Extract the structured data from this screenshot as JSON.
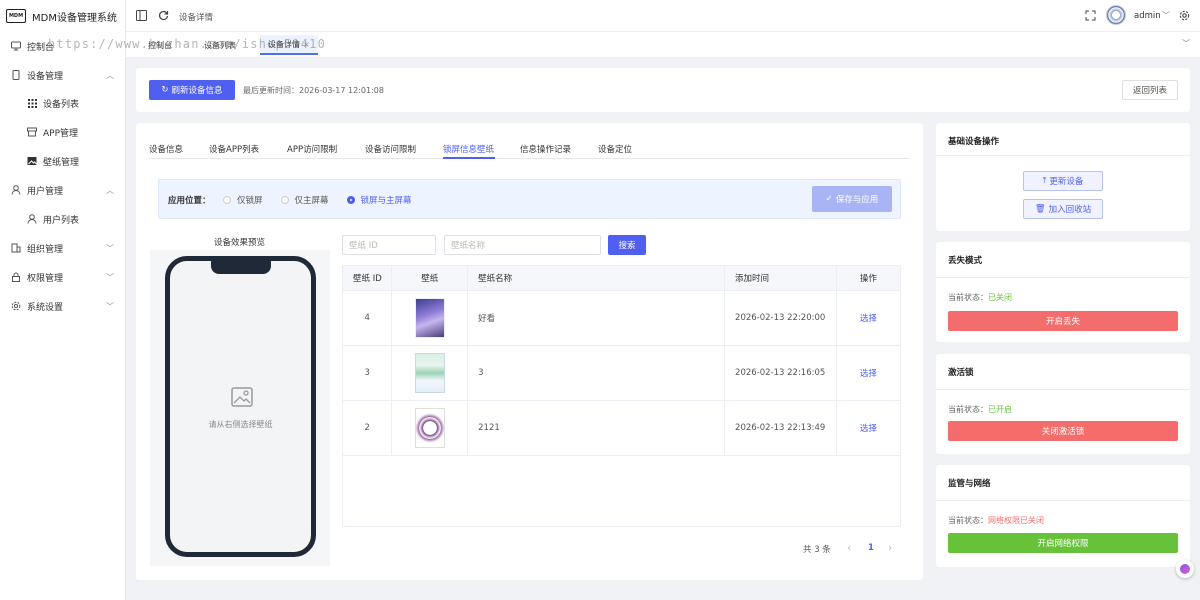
{
  "app": {
    "logo_text": "MDM",
    "title": "MDM设备管理系统"
  },
  "sidebar": {
    "items": [
      {
        "label": "控制台",
        "icon": "monitor-icon"
      },
      {
        "label": "设备管理",
        "icon": "phone-icon"
      },
      {
        "label": "设备列表",
        "icon": "grid-icon"
      },
      {
        "label": "APP管理",
        "icon": "box-icon"
      },
      {
        "label": "壁纸管理",
        "icon": "image-icon"
      },
      {
        "label": "用户管理",
        "icon": "user-icon"
      },
      {
        "label": "用户列表",
        "icon": "user-icon"
      },
      {
        "label": "组织管理",
        "icon": "org-icon"
      },
      {
        "label": "权限管理",
        "icon": "lock-icon"
      },
      {
        "label": "系统设置",
        "icon": "gear-icon"
      }
    ]
  },
  "header": {
    "breadcrumb": "设备详情",
    "user": "admin"
  },
  "tags": [
    {
      "label": "控制台"
    },
    {
      "label": "设备列表"
    },
    {
      "label": "设备详情"
    }
  ],
  "watermark": "https://www.huzhan.com/ishop51410",
  "toolbar": {
    "refresh_label": "刷新设备信息",
    "last_update": "最后更新时间：2026-03-17 12:01:08",
    "back_label": "返回列表"
  },
  "tabs": [
    {
      "label": "设备信息"
    },
    {
      "label": "设备APP列表"
    },
    {
      "label": "APP访问限制"
    },
    {
      "label": "设备访问限制"
    },
    {
      "label": "锁屏信息壁纸"
    },
    {
      "label": "信息操作记录"
    },
    {
      "label": "设备定位"
    }
  ],
  "apply": {
    "label": "应用位置：",
    "options": [
      "仅锁屏",
      "仅主屏幕",
      "锁屏与主屏幕"
    ],
    "selected": "锁屏与主屏幕",
    "save_label": "保存与应用"
  },
  "preview": {
    "title": "设备效果预览",
    "hint": "请从右侧选择壁纸"
  },
  "search": {
    "id_placeholder": "壁纸 ID",
    "name_placeholder": "壁纸名称",
    "button": "搜索"
  },
  "table": {
    "headers": [
      "壁纸 ID",
      "壁纸",
      "壁纸名称",
      "添加时间",
      "操作"
    ],
    "rows": [
      {
        "id": "4",
        "name": "好看",
        "time": "2026-02-13 22:20:00",
        "action": "选择"
      },
      {
        "id": "3",
        "name": "3",
        "time": "2026-02-13 22:16:05",
        "action": "选择"
      },
      {
        "id": "2",
        "name": "2121",
        "time": "2026-02-13 22:13:49",
        "action": "选择"
      }
    ]
  },
  "pagination": {
    "total": "共 3 条",
    "page": "1",
    "prev": "‹",
    "next": "›"
  },
  "right": {
    "basic": {
      "title": "基础设备操作",
      "update_label": "更新设备",
      "recycle_label": "加入回收站"
    },
    "lost": {
      "title": "丢失模式",
      "status_label": "当前状态：",
      "status": "已关闭",
      "status_color": "#67c23a",
      "button": "开启丢失"
    },
    "activation": {
      "title": "激活锁",
      "status_label": "当前状态：",
      "status": "已开启",
      "status_color": "#67c23a",
      "button": "关闭激活锁"
    },
    "network": {
      "title": "监管与网络",
      "status_label": "当前状态：",
      "status": "网络权限已关闭",
      "status_color": "#f56c6c",
      "button": "开启网络权限"
    }
  },
  "colors": {
    "accent": "#4f5ff0",
    "danger": "#f56c6c",
    "success": "#67c23a"
  }
}
